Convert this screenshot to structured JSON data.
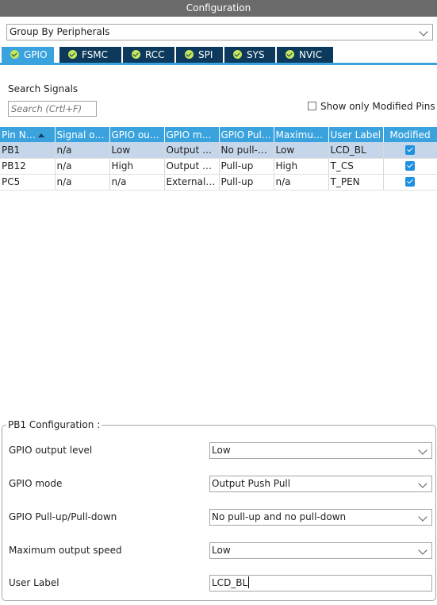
{
  "title": "Configuration",
  "group_select": {
    "value": "Group By Peripherals"
  },
  "tabs": [
    {
      "label": "GPIO",
      "active": true
    },
    {
      "label": "FSMC",
      "active": false
    },
    {
      "label": "RCC",
      "active": false
    },
    {
      "label": "SPI",
      "active": false
    },
    {
      "label": "SYS",
      "active": false
    },
    {
      "label": "NVIC",
      "active": false
    }
  ],
  "search": {
    "label": "Search Signals",
    "placeholder": "Search (Crtl+F)"
  },
  "modified_only": {
    "label": "Show only Modified Pins",
    "checked": false
  },
  "table": {
    "headers": [
      "Pin N…",
      "Signal on…",
      "GPIO out…",
      "GPIO mo…",
      "GPIO Pul…",
      "Maximu…",
      "User Label",
      "Modified"
    ],
    "rows": [
      {
        "pin": "PB1",
        "signal": "n/a",
        "output": "Low",
        "mode": "Output P…",
        "pull": "No pull-u…",
        "speed": "Low",
        "label": "LCD_BL",
        "modified": true,
        "selected": true
      },
      {
        "pin": "PB12",
        "signal": "n/a",
        "output": "High",
        "mode": "Output P…",
        "pull": "Pull-up",
        "speed": "High",
        "label": "T_CS",
        "modified": true,
        "selected": false
      },
      {
        "pin": "PC5",
        "signal": "n/a",
        "output": "n/a",
        "mode": "External …",
        "pull": "Pull-up",
        "speed": "n/a",
        "label": "T_PEN",
        "modified": true,
        "selected": false
      }
    ]
  },
  "config": {
    "legend": "PB1 Configuration :",
    "output_level": {
      "label": "GPIO output level",
      "value": "Low"
    },
    "mode": {
      "label": "GPIO mode",
      "value": "Output Push Pull"
    },
    "pull": {
      "label": "GPIO Pull-up/Pull-down",
      "value": "No pull-up and no pull-down"
    },
    "speed": {
      "label": "Maximum output speed",
      "value": "Low"
    },
    "user_label": {
      "label": "User Label",
      "value": "LCD_BL"
    }
  },
  "colors": {
    "accent": "#3aa3de",
    "tab_bg": "#0d3a5c",
    "title_bg": "#6b6b6b",
    "selected_row": "#c6d6ea",
    "check_green": "#c4e65a"
  }
}
